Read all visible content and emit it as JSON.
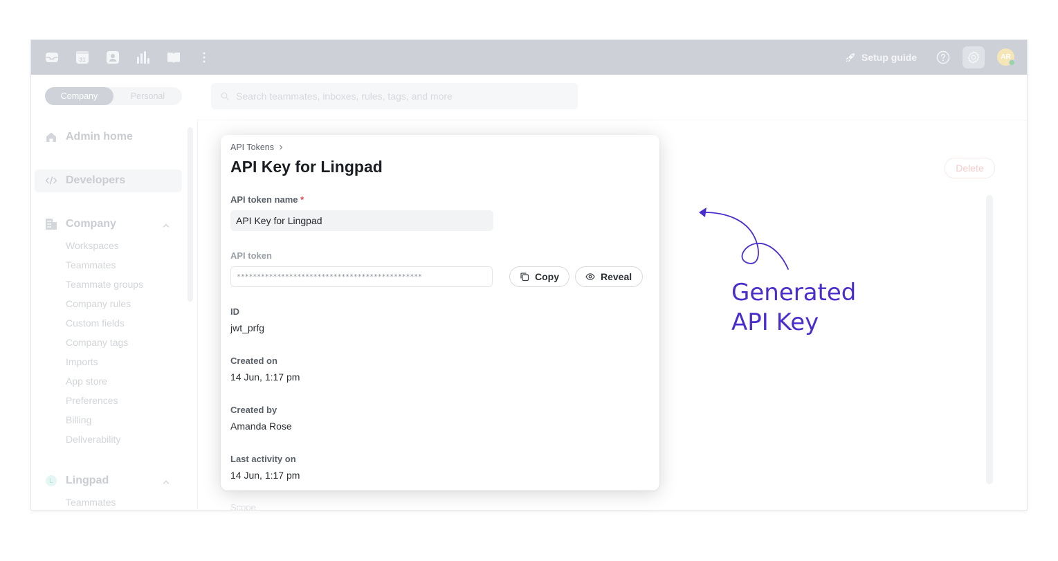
{
  "topbar": {
    "icons": [
      "inbox-icon",
      "calendar-icon",
      "contacts-icon",
      "analytics-icon",
      "knowledge-base-icon",
      "more-icon"
    ],
    "calendar_day": "31",
    "setup_guide_label": "Setup guide",
    "avatar_initials": "AR"
  },
  "sidebar": {
    "toggle": {
      "company": "Company",
      "personal": "Personal"
    },
    "admin_home": "Admin home",
    "developers": "Developers",
    "company_section": {
      "label": "Company",
      "items": [
        "Workspaces",
        "Teammates",
        "Teammate groups",
        "Company rules",
        "Custom fields",
        "Company tags",
        "Imports",
        "App store",
        "Preferences",
        "Billing",
        "Deliverability"
      ]
    },
    "workspace_section": {
      "badge": "L",
      "label": "Lingpad",
      "items": [
        "Teammates"
      ]
    }
  },
  "search": {
    "placeholder": "Search teammates, inboxes, rules, tags, and more"
  },
  "page": {
    "delete_label": "Delete",
    "scope_label": "Scope"
  },
  "modal": {
    "breadcrumb": "API Tokens",
    "title": "API Key for Lingpad",
    "token_name_label": "API token name",
    "required_mark": "*",
    "token_name_value": "API Key for Lingpad",
    "token_label": "API token",
    "token_masked": "**********************************************",
    "copy_label": "Copy",
    "reveal_label": "Reveal",
    "id_label": "ID",
    "id_value": "jwt_prfg",
    "created_on_label": "Created on",
    "created_on_value": "14 Jun, 1:17 pm",
    "created_by_label": "Created by",
    "created_by_value": "Amanda Rose",
    "last_activity_label": "Last activity on",
    "last_activity_value": "14 Jun, 1:17 pm"
  },
  "annotation": {
    "line1": "Generated",
    "line2": "API Key",
    "color": "#4b2ccc"
  }
}
